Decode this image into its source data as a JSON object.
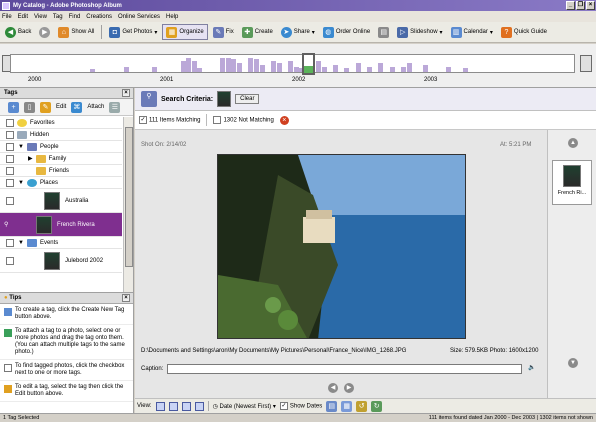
{
  "window": {
    "title": "My Catalog - Adobe Photoshop Album"
  },
  "menu": [
    "File",
    "Edit",
    "View",
    "Tag",
    "Find",
    "Creations",
    "Online Services",
    "Help"
  ],
  "toolbar": {
    "back": "Back",
    "show_all": "Show All",
    "get_photos": "Get Photos",
    "organize": "Organize",
    "fix": "Fix",
    "create": "Create",
    "share": "Share",
    "order_online": "Order Online",
    "slideshow": "Slideshow",
    "calendar": "Calendar",
    "quick_guide": "Quick Guide"
  },
  "timeline": {
    "years": [
      "2000",
      "2001",
      "2002",
      "2003"
    ],
    "bars": [
      {
        "pos": 0.14,
        "h": 0.15
      },
      {
        "pos": 0.2,
        "h": 0.25
      },
      {
        "pos": 0.25,
        "h": 0.3
      },
      {
        "pos": 0.3,
        "h": 0.6
      },
      {
        "pos": 0.31,
        "h": 0.8
      },
      {
        "pos": 0.32,
        "h": 0.6
      },
      {
        "pos": 0.33,
        "h": 0.2
      },
      {
        "pos": 0.37,
        "h": 0.8
      },
      {
        "pos": 0.38,
        "h": 0.8
      },
      {
        "pos": 0.39,
        "h": 0.7
      },
      {
        "pos": 0.4,
        "h": 0.5
      },
      {
        "pos": 0.42,
        "h": 0.8
      },
      {
        "pos": 0.43,
        "h": 0.7
      },
      {
        "pos": 0.44,
        "h": 0.4
      },
      {
        "pos": 0.46,
        "h": 0.6
      },
      {
        "pos": 0.47,
        "h": 0.5
      },
      {
        "pos": 0.49,
        "h": 0.6
      },
      {
        "pos": 0.5,
        "h": 0.3
      },
      {
        "pos": 0.51,
        "h": 0.2
      },
      {
        "pos": 0.54,
        "h": 0.6
      },
      {
        "pos": 0.55,
        "h": 0.3
      },
      {
        "pos": 0.57,
        "h": 0.4
      },
      {
        "pos": 0.59,
        "h": 0.2
      },
      {
        "pos": 0.61,
        "h": 0.5
      },
      {
        "pos": 0.63,
        "h": 0.3
      },
      {
        "pos": 0.65,
        "h": 0.5
      },
      {
        "pos": 0.67,
        "h": 0.3
      },
      {
        "pos": 0.69,
        "h": 0.3
      },
      {
        "pos": 0.7,
        "h": 0.5
      },
      {
        "pos": 0.73,
        "h": 0.4
      },
      {
        "pos": 0.77,
        "h": 0.3
      },
      {
        "pos": 0.8,
        "h": 0.2
      }
    ]
  },
  "tags_panel": {
    "title": "Tags",
    "edit": "Edit",
    "attach": "Attach",
    "items": [
      {
        "label": "Favorites",
        "type": "category"
      },
      {
        "label": "Hidden",
        "type": "category"
      },
      {
        "label": "People",
        "type": "category"
      },
      {
        "label": "Family",
        "type": "sub"
      },
      {
        "label": "Friends",
        "type": "sub"
      },
      {
        "label": "Places",
        "type": "category"
      },
      {
        "label": "Australia",
        "type": "photo"
      },
      {
        "label": "French Rivera",
        "type": "photo",
        "selected": true
      },
      {
        "label": "Events",
        "type": "category"
      },
      {
        "label": "Julebord 2002",
        "type": "photo"
      }
    ]
  },
  "tips_panel": {
    "title": "Tips",
    "tips": [
      "To create a tag, click the Create New Tag button above.",
      "To attach a tag to a photo, select one or more photos and drag the tag onto them. (You can attach multiple tags to the same photo.)",
      "To find tagged photos, click the checkbox next to one or more tags.",
      "To edit a tag, select the tag then click the Edit button above."
    ]
  },
  "criteria": {
    "label": "Search Criteria:",
    "clear": "Clear"
  },
  "match": {
    "matching": "111 Items Matching",
    "not_matching": "1302 Not Matching"
  },
  "viewer": {
    "shot_on": "Shot On: 2/14/02",
    "at": "At: 5:21 PM",
    "path": "D:\\Documents and Settings\\aron\\My Documents\\My Pictures\\Personal\\France_Nice\\IMG_1268.JPG",
    "size": "Size: 579.5KB  Photo: 1600x1200",
    "caption_label": "Caption:"
  },
  "right_strip": {
    "tag_label": "French Ri..."
  },
  "viewbar": {
    "view": "View:",
    "sort": "Date (Newest First)",
    "show_dates": "Show Dates"
  },
  "status": {
    "left": "1 Tag Selected",
    "right": "111 items found dated Jan 2000 - Dec 2003 | 1302 items not shown"
  },
  "colors": {
    "accent": "#7f2f8f",
    "title": "#5d4a9c",
    "timeline_bar": "#bba8d8"
  }
}
